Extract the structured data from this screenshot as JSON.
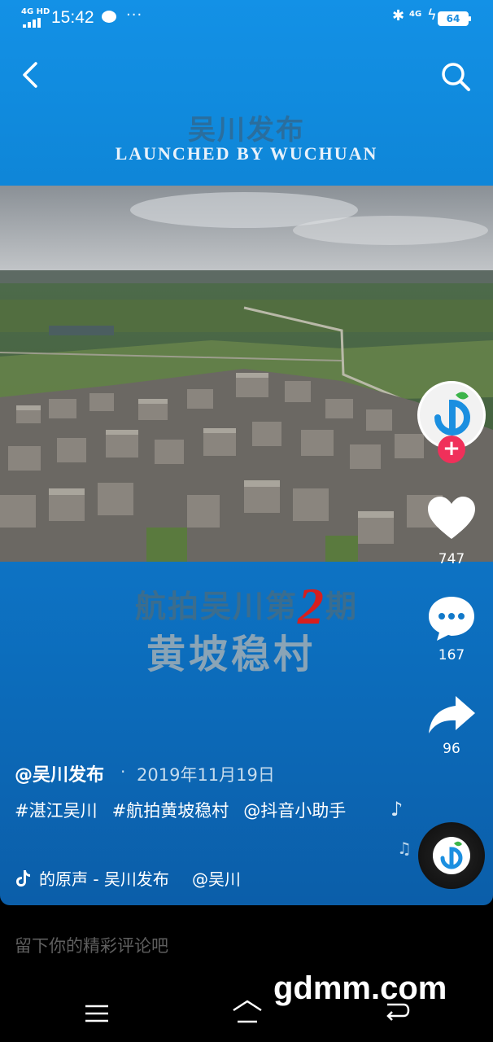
{
  "status_bar": {
    "network": "4G HD",
    "time": "15:42",
    "more": "···",
    "network_right": "4G",
    "battery": "64"
  },
  "header": {
    "banner_title": "吴川发布",
    "banner_subtitle": "LAUNCHED BY WUCHUAN"
  },
  "video_overlay": {
    "line1_before": "航拍吴川第",
    "line1_number": "2",
    "line1_after": "期",
    "line2": "黄坡稳村"
  },
  "actions": {
    "like_count": "747",
    "comment_count": "167",
    "share_count": "96",
    "follow_symbol": "+"
  },
  "post": {
    "author": "@吴川发布",
    "separator": "·",
    "date": "2019年11月19日",
    "hashtag1": "#湛江吴川",
    "hashtag2": "#航拍黄坡稳村",
    "mention_text": "@抖音小助手",
    "music_title": "的原声 - 吴川发布",
    "music_mention": "@吴川"
  },
  "comment_bar": {
    "placeholder": "留下你的精彩评论吧"
  },
  "watermark": "gdmm.com",
  "colors": {
    "card_blue_top": "#1391e6",
    "card_blue_bottom": "#0b5ea9",
    "follow_red": "#f0305a",
    "episode_red": "#d61f1f"
  },
  "icons": [
    "back-icon",
    "search-icon",
    "heart-icon",
    "comment-icon",
    "share-icon",
    "music-note-icon",
    "tiktok-icon",
    "menu-icon",
    "home-icon",
    "back-nav-icon"
  ]
}
